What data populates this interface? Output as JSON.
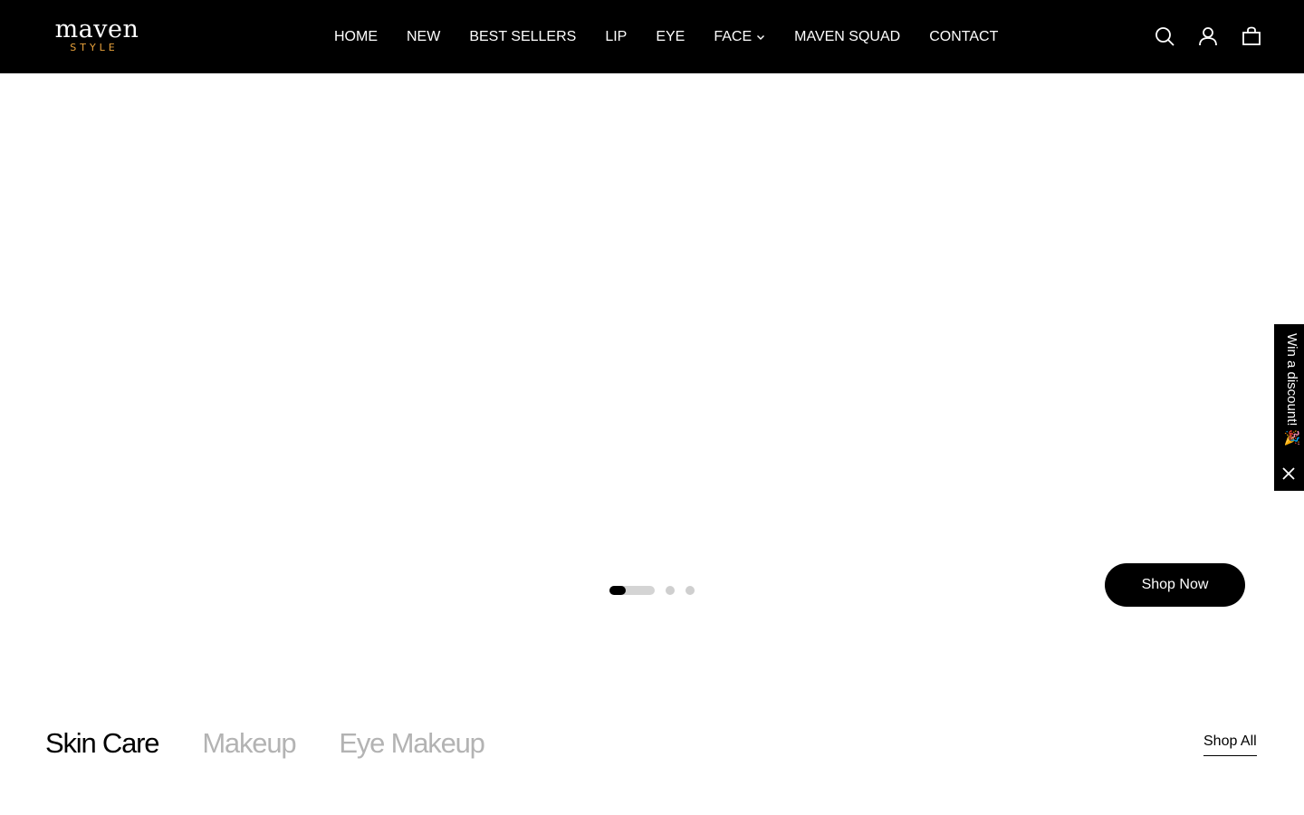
{
  "logo": {
    "main": "maven",
    "sub": "STYLE",
    "sub_color": "#e9a23b"
  },
  "nav": {
    "items": [
      {
        "label": "HOME"
      },
      {
        "label": "NEW"
      },
      {
        "label": "BEST SELLERS"
      },
      {
        "label": "LIP"
      },
      {
        "label": "EYE"
      },
      {
        "label": "FACE",
        "has_dropdown": true
      },
      {
        "label": "MAVEN SQUAD"
      },
      {
        "label": "CONTACT"
      }
    ]
  },
  "header_icons": [
    "search-icon",
    "account-icon",
    "cart-icon"
  ],
  "hero": {
    "slide_count": 3,
    "active_slide": 1,
    "active_slide_progress": 0.36,
    "cta_label": "Shop Now"
  },
  "promo": {
    "label": "Win a discount! 🎉"
  },
  "categories": {
    "tabs": [
      {
        "label": "Skin Care",
        "active": true
      },
      {
        "label": "Makeup",
        "active": false
      },
      {
        "label": "Eye Makeup",
        "active": false
      }
    ],
    "shop_all_label": "Shop All"
  },
  "colors": {
    "header_bg": "#000000",
    "accent": "#e9a23b",
    "inactive_tab": "#b3b3b3"
  }
}
